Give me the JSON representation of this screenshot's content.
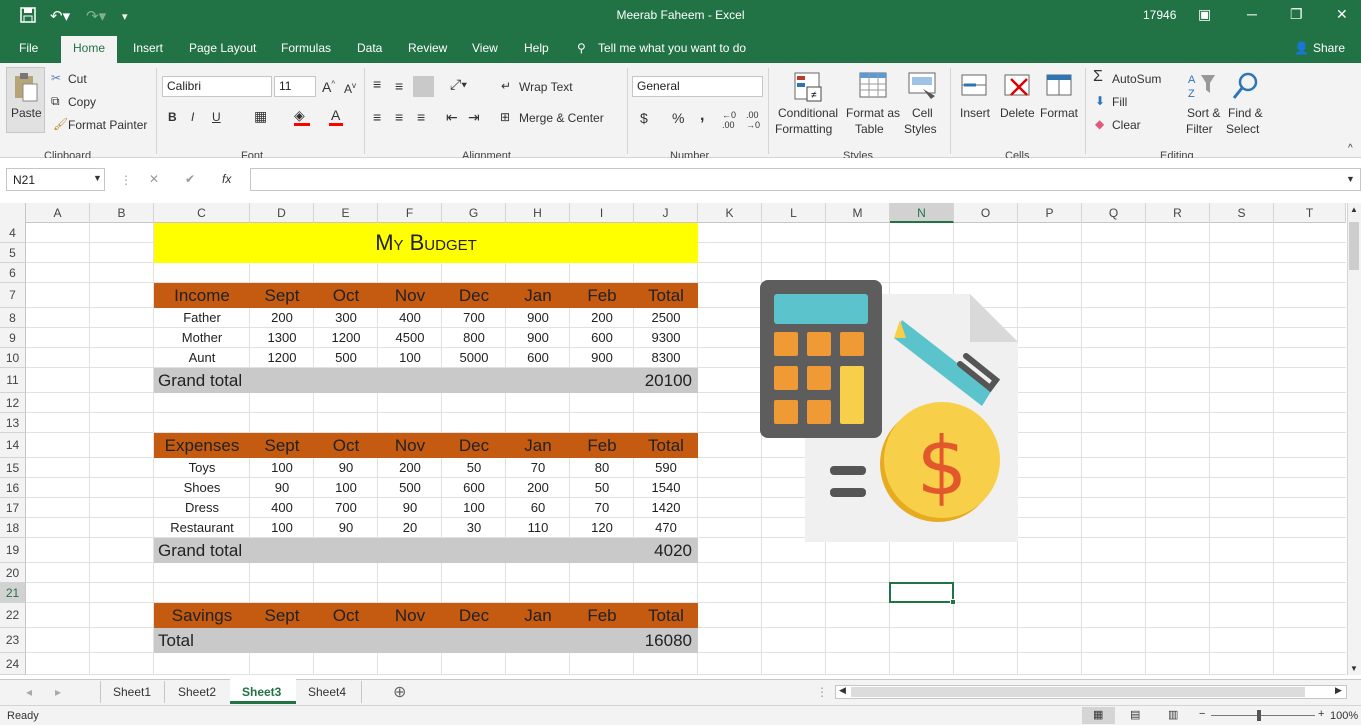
{
  "window": {
    "title": "Meerab Faheem  -  Excel",
    "counter": "17946"
  },
  "tabs": [
    "File",
    "Home",
    "Insert",
    "Page Layout",
    "Formulas",
    "Data",
    "Review",
    "View",
    "Help"
  ],
  "tell_me": "Tell me what you want to do",
  "share": "Share",
  "ribbon": {
    "clipboard": {
      "paste": "Paste",
      "cut": "Cut",
      "copy": "Copy",
      "format_painter": "Format Painter",
      "label": "Clipboard"
    },
    "font": {
      "name": "Calibri",
      "size": "11",
      "bold": "B",
      "italic": "I",
      "underline": "U",
      "label": "Font"
    },
    "alignment": {
      "wrap": "Wrap Text",
      "merge": "Merge & Center",
      "label": "Alignment"
    },
    "number": {
      "format": "General",
      "currency": "$",
      "percent": "%",
      "comma": ",",
      "label": "Number"
    },
    "styles": {
      "conditional1": "Conditional",
      "conditional2": "Formatting",
      "table1": "Format as",
      "table2": "Table",
      "cell1": "Cell",
      "cell2": "Styles",
      "label": "Styles"
    },
    "cells": {
      "insert": "Insert",
      "delete": "Delete",
      "format": "Format",
      "label": "Cells"
    },
    "editing": {
      "autosum": "AutoSum",
      "fill": "Fill",
      "clear": "Clear",
      "sort1": "Sort &",
      "sort2": "Filter",
      "find1": "Find &",
      "find2": "Select",
      "label": "Editing"
    }
  },
  "namebox": "N21",
  "fx": "fx",
  "columns": [
    "A",
    "B",
    "C",
    "D",
    "E",
    "F",
    "G",
    "H",
    "I",
    "J",
    "K",
    "L",
    "M",
    "N",
    "O",
    "P",
    "Q",
    "R",
    "S",
    "T"
  ],
  "rows": [
    "4",
    "5",
    "6",
    "7",
    "8",
    "9",
    "10",
    "11",
    "12",
    "13",
    "14",
    "15",
    "16",
    "17",
    "18",
    "19",
    "20",
    "21",
    "22",
    "23",
    "24"
  ],
  "sheet": {
    "title": "My Budget",
    "income": {
      "header": [
        "Income",
        "Sept",
        "Oct",
        "Nov",
        "Dec",
        "Jan",
        "Feb",
        "Total"
      ],
      "rows": [
        [
          "Father",
          "200",
          "300",
          "400",
          "700",
          "900",
          "200",
          "2500"
        ],
        [
          "Mother",
          "1300",
          "1200",
          "4500",
          "800",
          "900",
          "600",
          "9300"
        ],
        [
          "Aunt",
          "1200",
          "500",
          "100",
          "5000",
          "600",
          "900",
          "8300"
        ]
      ],
      "grand_label": "Grand total",
      "grand_value": "20100"
    },
    "expenses": {
      "header": [
        "Expenses",
        "Sept",
        "Oct",
        "Nov",
        "Dec",
        "Jan",
        "Feb",
        "Total"
      ],
      "rows": [
        [
          "Toys",
          "100",
          "90",
          "200",
          "50",
          "70",
          "80",
          "590"
        ],
        [
          "Shoes",
          "90",
          "100",
          "500",
          "600",
          "200",
          "50",
          "1540"
        ],
        [
          "Dress",
          "400",
          "700",
          "90",
          "100",
          "60",
          "70",
          "1420"
        ],
        [
          "Restaurant",
          "100",
          "90",
          "20",
          "30",
          "110",
          "120",
          "470"
        ]
      ],
      "grand_label": "Grand total",
      "grand_value": "4020"
    },
    "savings": {
      "header": [
        "Savings",
        "Sept",
        "Oct",
        "Nov",
        "Dec",
        "Jan",
        "Feb",
        "Total"
      ],
      "total_label": "Total",
      "total_value": "16080"
    }
  },
  "sheet_tabs": [
    "Sheet1",
    "Sheet2",
    "Sheet3",
    "Sheet4"
  ],
  "active_sheet": "Sheet3",
  "status": {
    "ready": "Ready",
    "zoom": "100%"
  },
  "colors": {
    "excel_green": "#217346",
    "header_orange": "#c55a11",
    "title_yellow": "#ffff00",
    "total_gray": "#c9c9c9"
  }
}
